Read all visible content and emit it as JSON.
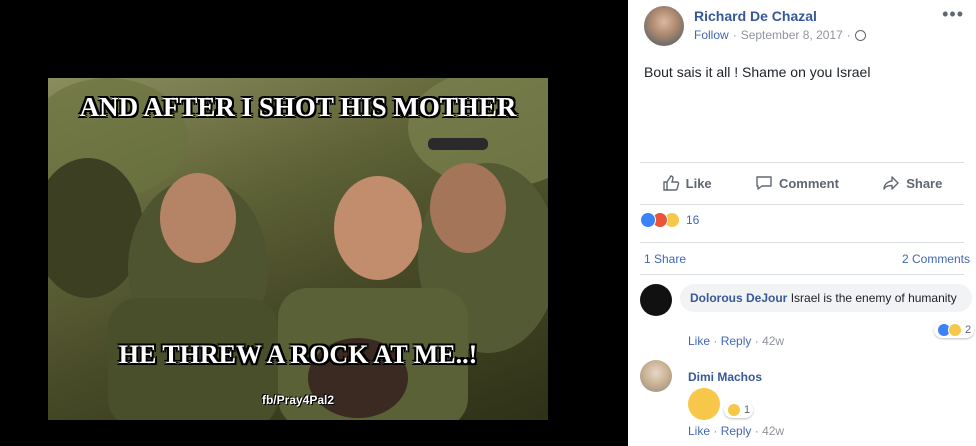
{
  "media": {
    "top_caption": "AND AFTER I SHOT HIS MOTHER",
    "bottom_caption": "HE THREW A ROCK AT ME..!",
    "watermark": "fb/Pray4Pal2"
  },
  "post": {
    "author": "Richard De Chazal",
    "follow_label": "Follow",
    "separator": "·",
    "date": "September 8, 2017",
    "privacy_icon": "globe-icon",
    "more_icon": "more-options-icon",
    "more_label": "•••",
    "text": "Bout sais it all ! Shame on you Israel"
  },
  "actions": {
    "like_label": "Like",
    "comment_label": "Comment",
    "share_label": "Share"
  },
  "reactions": {
    "types": [
      "like",
      "angry",
      "sad"
    ],
    "count": "16"
  },
  "stats": {
    "shares": "1 Share",
    "comments": "2 Comments"
  },
  "comments": [
    {
      "author": "Dolorous DeJour",
      "text": "Israel is the enemy of humanity",
      "reaction_count": "2",
      "like_label": "Like",
      "reply_label": "Reply",
      "time": "42w"
    },
    {
      "author": "Dimi Machos",
      "text": "",
      "reaction_count": "1",
      "like_label": "Like",
      "reply_label": "Reply",
      "time": "42w"
    }
  ],
  "colors": {
    "link_blue": "#365899",
    "accent_blue": "#4267b2",
    "muted_gray": "#90949c"
  }
}
